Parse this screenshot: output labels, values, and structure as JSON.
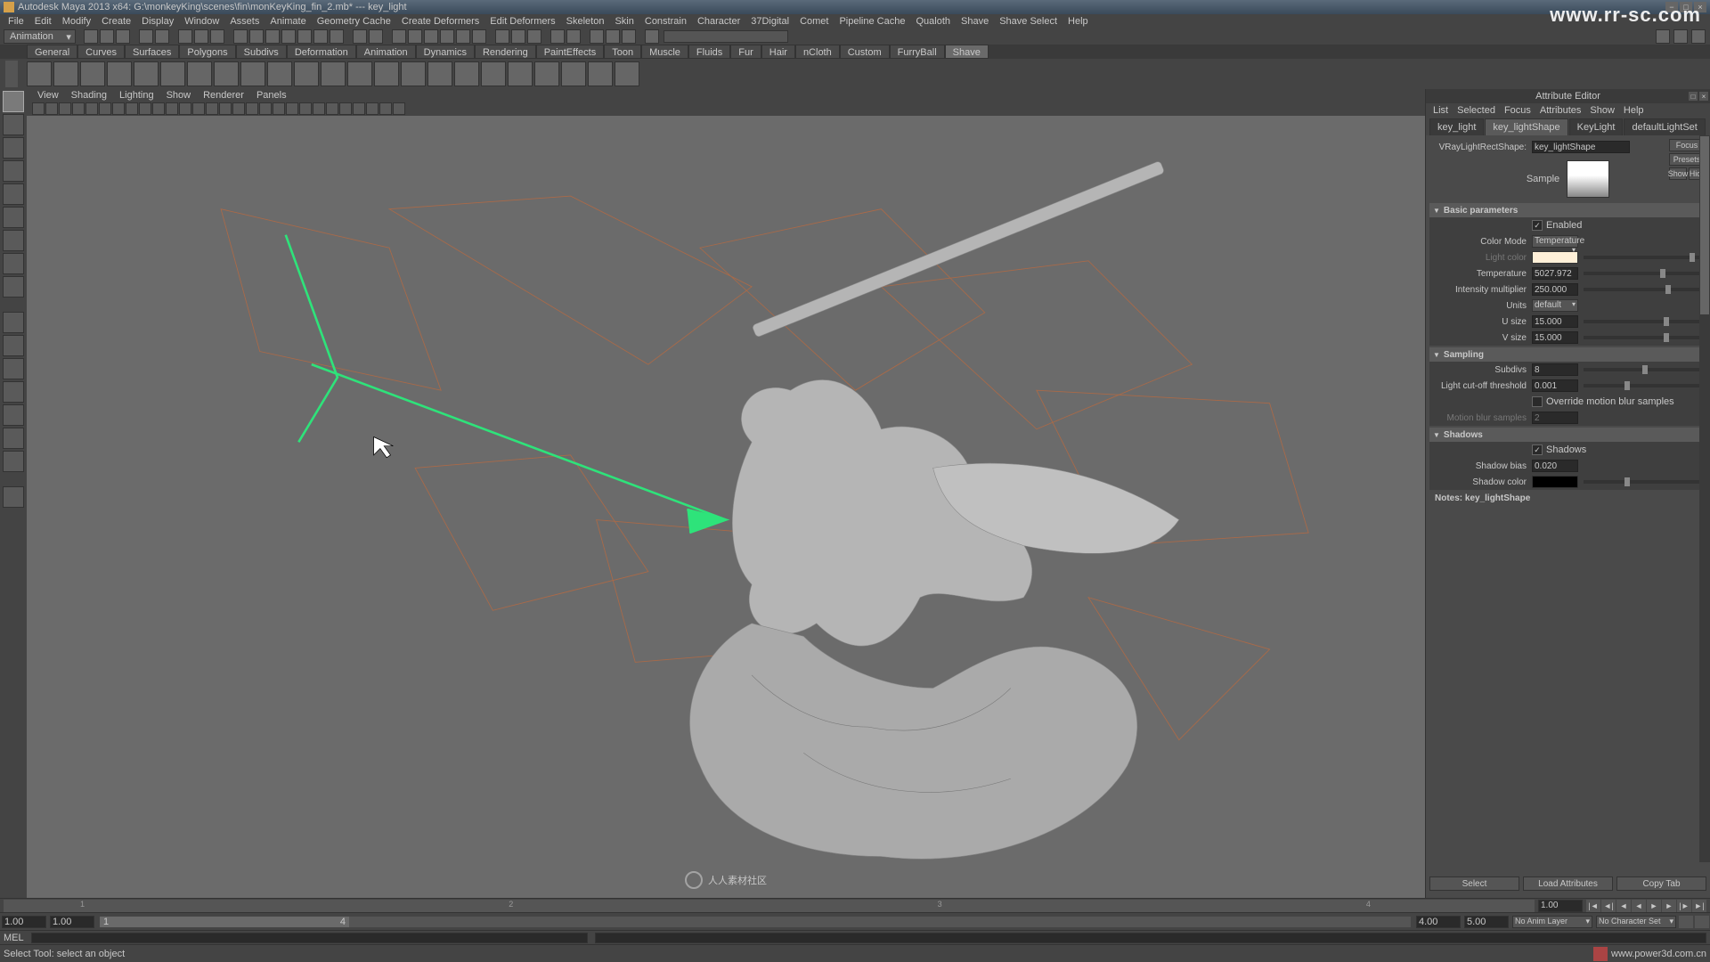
{
  "title": "Autodesk Maya 2013 x64:  G:\\monkeyKing\\scenes\\fin\\monKeyKing_fin_2.mb*   ---   key_light",
  "watermark_url": "www.rr-sc.com",
  "watermark_center": "人人素材社区",
  "menubar": [
    "File",
    "Edit",
    "Modify",
    "Create",
    "Display",
    "Window",
    "Assets",
    "Animate",
    "Geometry Cache",
    "Create Deformers",
    "Edit Deformers",
    "Skeleton",
    "Skin",
    "Constrain",
    "Character",
    "37Digital",
    "Comet",
    "Pipeline Cache",
    "Qualoth",
    "Shave",
    "Shave Select",
    "Help"
  ],
  "status_dropdown": "Animation",
  "shelf_tabs": [
    "General",
    "Curves",
    "Surfaces",
    "Polygons",
    "Subdivs",
    "Deformation",
    "Animation",
    "Dynamics",
    "Rendering",
    "PaintEffects",
    "Toon",
    "Muscle",
    "Fluids",
    "Fur",
    "Hair",
    "nCloth",
    "Custom",
    "FurryBall",
    "Shave"
  ],
  "shelf_active": "Shave",
  "panel_menu": [
    "View",
    "Shading",
    "Lighting",
    "Show",
    "Renderer",
    "Panels"
  ],
  "attr": {
    "title": "Attribute Editor",
    "menu": [
      "List",
      "Selected",
      "Focus",
      "Attributes",
      "Show",
      "Help"
    ],
    "tabs": [
      "key_light",
      "key_lightShape",
      "KeyLight",
      "defaultLightSet"
    ],
    "active_tab": "key_lightShape",
    "node_type_label": "VRayLightRectShape:",
    "node_name": "key_lightShape",
    "side_btns": {
      "focus": "Focus",
      "presets": "Presets",
      "show": "Show",
      "hide": "Hide"
    },
    "sample_label": "Sample",
    "sections": {
      "basic": {
        "title": "Basic parameters",
        "enabled": {
          "label": "Enabled",
          "checked": true
        },
        "color_mode": {
          "label": "Color Mode",
          "value": "Temperature"
        },
        "light_color": {
          "label": "Light color",
          "swatch": "#fff0d8"
        },
        "temperature": {
          "label": "Temperature",
          "value": "5027.972"
        },
        "intensity": {
          "label": "Intensity multiplier",
          "value": "250.000"
        },
        "units": {
          "label": "Units",
          "value": "default"
        },
        "usize": {
          "label": "U size",
          "value": "15.000"
        },
        "vsize": {
          "label": "V size",
          "value": "15.000"
        }
      },
      "sampling": {
        "title": "Sampling",
        "subdivs": {
          "label": "Subdivs",
          "value": "8"
        },
        "cutoff": {
          "label": "Light cut-off threshold",
          "value": "0.001"
        },
        "override_mb": {
          "label": "Override motion blur samples",
          "checked": false
        },
        "mb_samples": {
          "label": "Motion blur samples",
          "value": "2"
        }
      },
      "shadows": {
        "title": "Shadows",
        "shadows_on": {
          "label": "Shadows",
          "checked": true
        },
        "bias": {
          "label": "Shadow bias",
          "value": "0.020"
        },
        "color": {
          "label": "Shadow color",
          "swatch": "#000000"
        }
      }
    },
    "notes_label": "Notes: key_lightShape",
    "btns": {
      "select": "Select",
      "load": "Load Attributes",
      "copy": "Copy Tab"
    }
  },
  "timeline": {
    "ticks": [
      "1",
      "2",
      "3",
      "4"
    ],
    "current": "1.00",
    "range_start_outer": "1.00",
    "range_start_inner": "1.00",
    "range_end_inner": "4.00",
    "range_end_outer": "5.00",
    "handle_start": "1",
    "handle_end": "4",
    "anim_layer": "No Anim Layer",
    "char_set": "No Character Set"
  },
  "cmd_label": "MEL",
  "helpline": "Select Tool: select an object",
  "power3d": "www.power3d.com.cn"
}
